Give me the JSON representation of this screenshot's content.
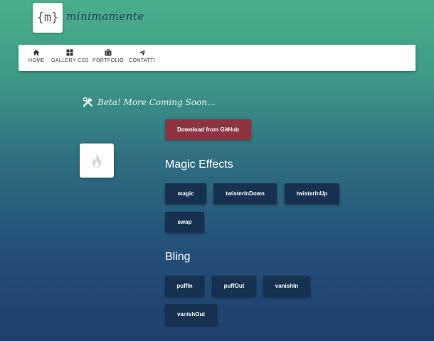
{
  "brand": {
    "logo_text": "{m}",
    "name": "minimamente"
  },
  "nav": {
    "items": [
      {
        "label": "HOME",
        "icon": "home-icon"
      },
      {
        "label": "GALLERY CSS",
        "icon": "grid-icon"
      },
      {
        "label": "PORTFOLIO",
        "icon": "briefcase-icon"
      },
      {
        "label": "CONTATTI",
        "icon": "paper-plane-icon"
      }
    ]
  },
  "tagline": {
    "text": "Beta! More Coming Soon...",
    "icon": "tools-icon"
  },
  "fire_icon": "fire-icon",
  "download_button": {
    "label": "Download from GitHub",
    "color": "#8d3440"
  },
  "sections": [
    {
      "title": "Magic Effects",
      "buttons": [
        "magic",
        "twisterInDown",
        "twisterInUp",
        "swap"
      ]
    },
    {
      "title": "Bling",
      "buttons": [
        "puffIn",
        "puffOut",
        "vanishIn",
        "vanishOut"
      ]
    }
  ],
  "colors": {
    "effect_button": "#16304f",
    "accent": "#8d3440"
  }
}
